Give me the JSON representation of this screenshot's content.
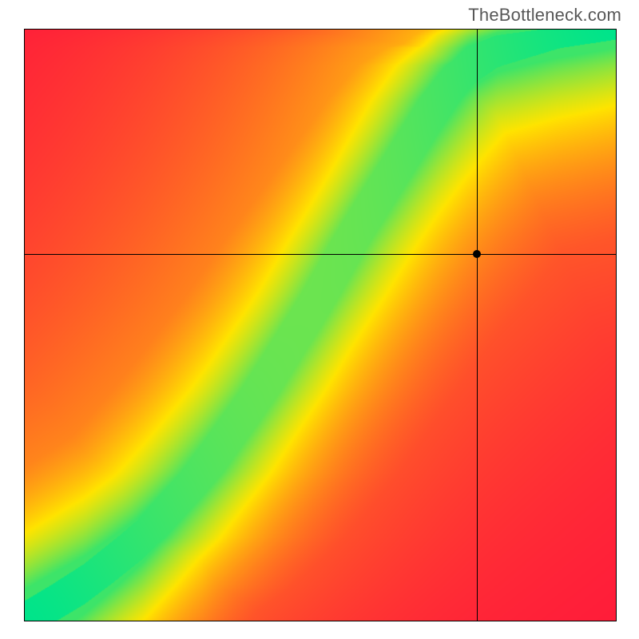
{
  "attribution": "TheBottleneck.com",
  "chart_data": {
    "type": "heatmap",
    "title": "",
    "xlabel": "",
    "ylabel": "",
    "xlim": [
      0,
      100
    ],
    "ylim": [
      0,
      100
    ],
    "color_scale": {
      "min_color": "#ff1a3b",
      "mid_color": "#ffe400",
      "max_color": "#00e58b",
      "min_value": 0.0,
      "mid_value": 0.5,
      "max_value": 1.0
    },
    "ridge": {
      "description": "narrow high-value band following a monotonically increasing curve from bottom-left to top-right with a slight S-bend",
      "points": [
        {
          "x": 0,
          "y": 0
        },
        {
          "x": 10,
          "y": 6
        },
        {
          "x": 20,
          "y": 14
        },
        {
          "x": 30,
          "y": 25
        },
        {
          "x": 40,
          "y": 39
        },
        {
          "x": 50,
          "y": 55
        },
        {
          "x": 55,
          "y": 64
        },
        {
          "x": 60,
          "y": 72
        },
        {
          "x": 65,
          "y": 80
        },
        {
          "x": 70,
          "y": 88
        },
        {
          "x": 75,
          "y": 94
        },
        {
          "x": 80,
          "y": 97
        },
        {
          "x": 90,
          "y": 99
        },
        {
          "x": 100,
          "y": 100
        }
      ],
      "band_width_pct": 7
    },
    "crosshair": {
      "x": 76.5,
      "y": 62
    }
  }
}
